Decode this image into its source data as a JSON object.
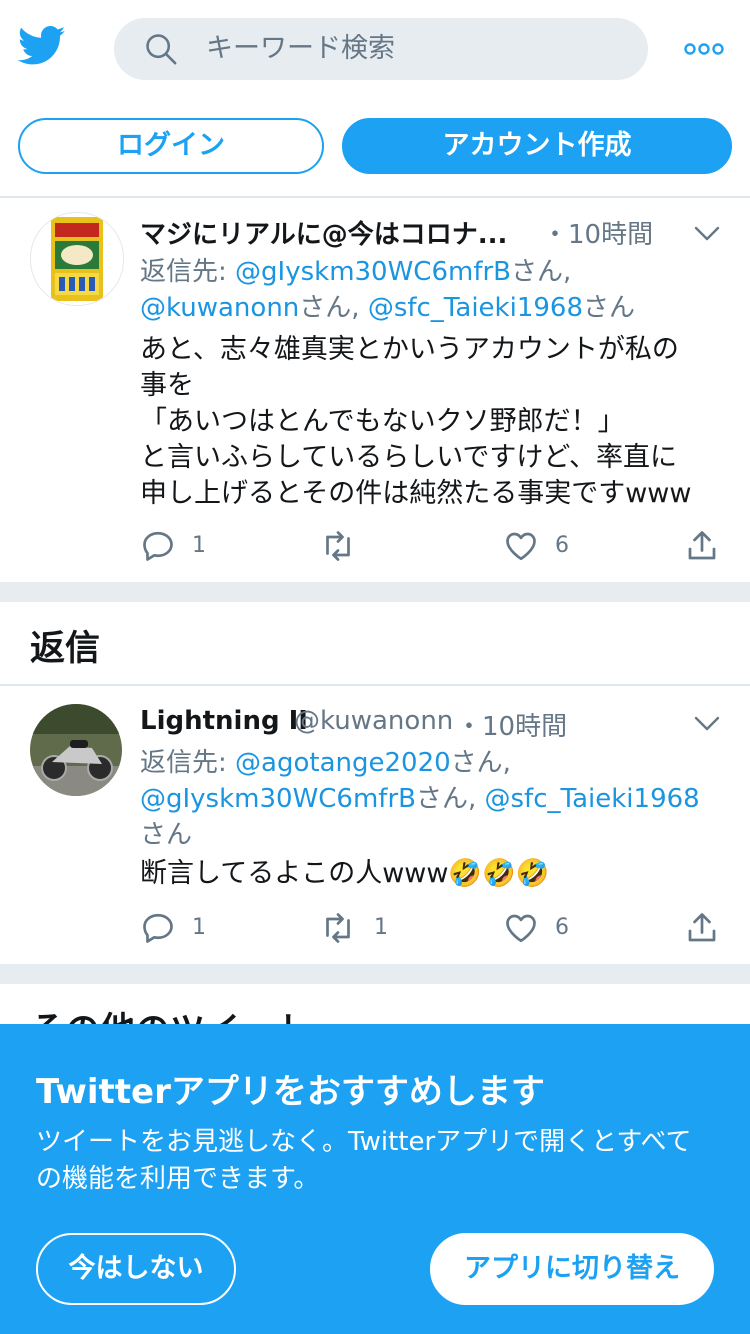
{
  "header": {
    "search_placeholder": "キーワード検索",
    "login_label": "ログイン",
    "signup_label": "アカウント作成"
  },
  "colors": {
    "accent": "#1da1f2",
    "mention": "#1b95e0",
    "muted": "#657786",
    "gap": "#e6ecf0"
  },
  "tweet1": {
    "name": "マジにリアルに@今はコロナ...",
    "time": "・10時間",
    "reply_prefix": "返信先: ",
    "mention1": "@gIyskm30WC6mfrB",
    "san1": "さん,",
    "mention2": "@kuwanonn",
    "san2": "さん, ",
    "mention3": "@sfc_Taieki1968",
    "san3": "さん",
    "text_lines": [
      "あと、志々雄真実とかいうアカウントが私の",
      "事を",
      "「あいつはとんでもないクソ野郎だ！」",
      "と言いふらしているらしいですけど、率直に",
      "申し上げるとその件は純然たる事実ですwww"
    ],
    "reply_count": "1",
    "like_count": "6"
  },
  "replies_section": {
    "title": "返信"
  },
  "tweet2": {
    "name": "Lightning II",
    "handle": "@kuwanonn",
    "time": "・10時間",
    "reply_prefix": "返信先: ",
    "mention1": "@agotange2020",
    "san1": "さん,",
    "mention2": "@gIyskm30WC6mfrB",
    "san2": "さん, ",
    "mention3": "@sfc_Taieki1968",
    "san3": "さん",
    "text": "断言してるよこの人www🤣🤣🤣",
    "reply_count": "1",
    "retweet_count": "1",
    "like_count": "6"
  },
  "other_section": {
    "title": "その他のツイート"
  },
  "banner": {
    "title": "Twitterアプリをおすすめします",
    "text": "ツイートをお見逃しなく。Twitterアプリで開くとすべての機能を利用できます。",
    "not_now_label": "今はしない",
    "switch_label": "アプリに切り替え"
  }
}
